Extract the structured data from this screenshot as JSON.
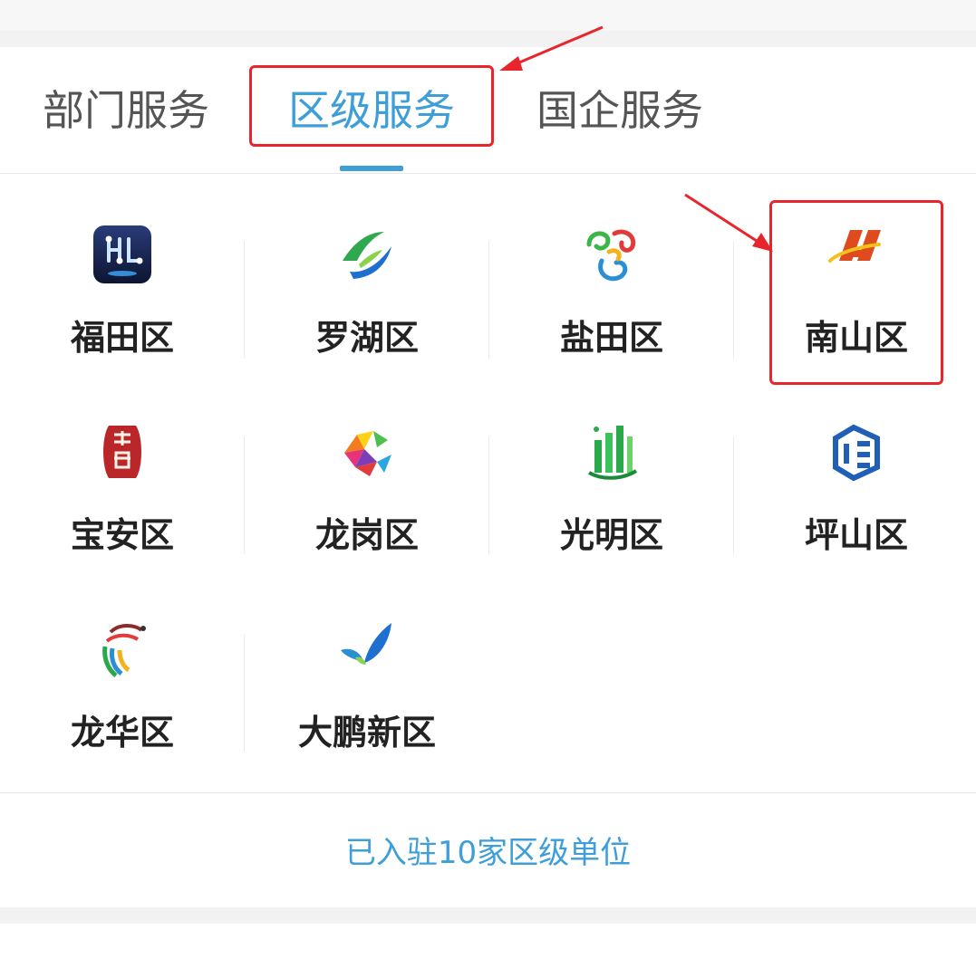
{
  "tabs": [
    {
      "label": "部门服务"
    },
    {
      "label": "区级服务"
    },
    {
      "label": "国企服务"
    }
  ],
  "districts": [
    {
      "label": "福田区",
      "icon": "futian-logo-icon"
    },
    {
      "label": "罗湖区",
      "icon": "luohu-logo-icon"
    },
    {
      "label": "盐田区",
      "icon": "yantian-logo-icon"
    },
    {
      "label": "南山区",
      "icon": "nanshan-logo-icon"
    },
    {
      "label": "宝安区",
      "icon": "baoan-seal-icon"
    },
    {
      "label": "龙岗区",
      "icon": "longgang-logo-icon"
    },
    {
      "label": "光明区",
      "icon": "guangming-logo-icon"
    },
    {
      "label": "坪山区",
      "icon": "pingshan-logo-icon"
    },
    {
      "label": "龙华区",
      "icon": "longhua-logo-icon"
    },
    {
      "label": "大鹏新区",
      "icon": "dapeng-logo-icon"
    }
  ],
  "footer": {
    "link": "已入驻10家区级单位"
  },
  "colors": {
    "accent": "#3d9ed8",
    "annotation": "#e8252b"
  }
}
